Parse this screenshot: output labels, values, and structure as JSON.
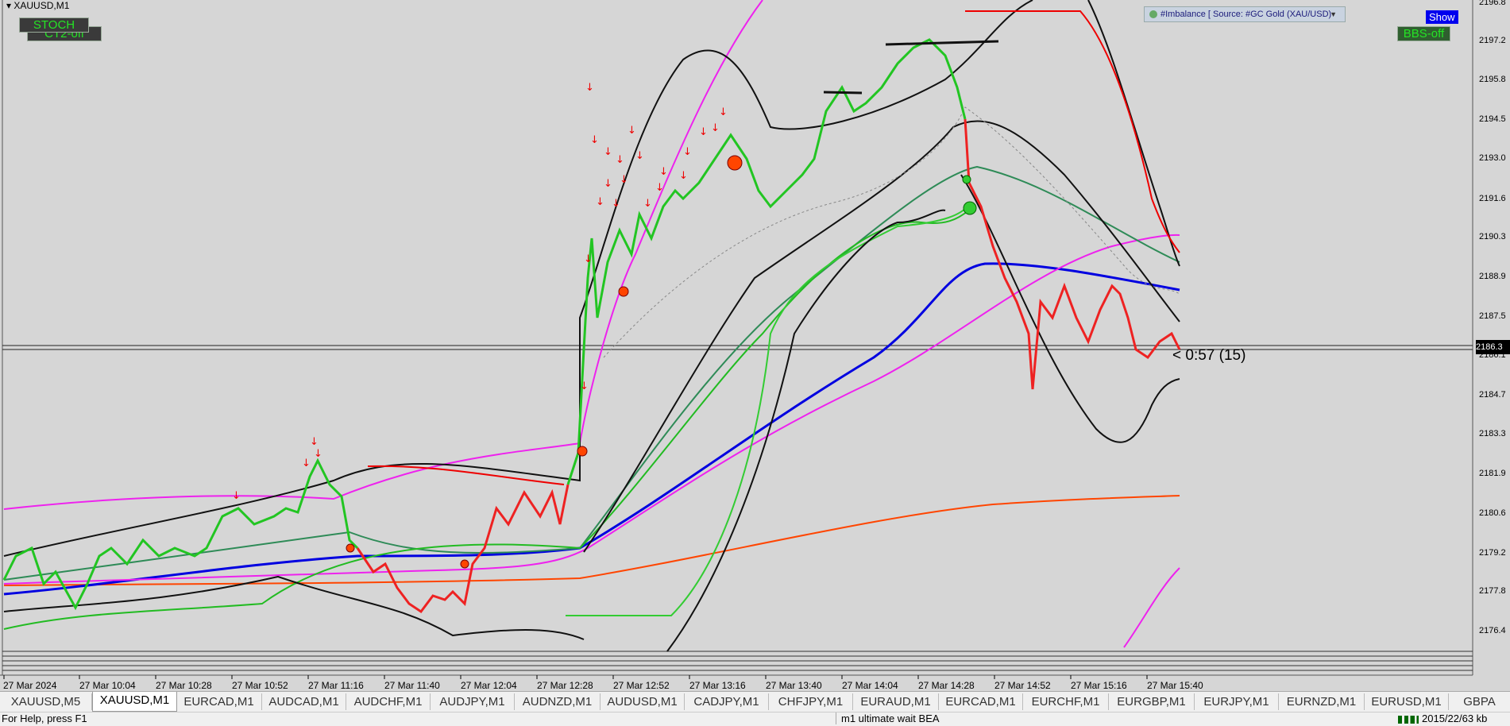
{
  "header": {
    "symbol": "XAUUSD,M1"
  },
  "indicators": {
    "stoch": "STOCH",
    "ct2": "CT2-off",
    "bbs": "BBS-off",
    "show": "Show",
    "imbalance": "#Imbalance [ Source: #GC Gold (XAU/USD)"
  },
  "timer": "< 0:57 (15)",
  "price_axis": [
    "2196.8",
    "2197.2",
    "2195.8",
    "2194.5",
    "2193.0",
    "2191.6",
    "2190.3",
    "2188.9",
    "2187.5",
    "2186.1",
    "2184.7",
    "2183.3",
    "2181.9",
    "2180.6",
    "2179.2",
    "2177.8",
    "2176.4"
  ],
  "current_price": "2186.3",
  "time_axis": [
    "27 Mar 2024",
    "27 Mar 10:04",
    "27 Mar 10:28",
    "27 Mar 10:52",
    "27 Mar 11:16",
    "27 Mar 11:40",
    "27 Mar 12:04",
    "27 Mar 12:28",
    "27 Mar 12:52",
    "27 Mar 13:16",
    "27 Mar 13:40",
    "27 Mar 14:04",
    "27 Mar 14:28",
    "27 Mar 14:52",
    "27 Mar 15:16",
    "27 Mar 15:40"
  ],
  "tabs": [
    "XAUUSD,M5",
    "XAUUSD,M1",
    "EURCAD,M1",
    "AUDCAD,M1",
    "AUDCHF,M1",
    "AUDJPY,M1",
    "AUDNZD,M1",
    "AUDUSD,M1",
    "CADJPY,M1",
    "CHFJPY,M1",
    "EURAUD,M1",
    "EURCAD,M1",
    "EURCHF,M1",
    "EURGBP,M1",
    "EURJPY,M1",
    "EURNZD,M1",
    "EURUSD,M1",
    "GBPA"
  ],
  "active_tab": "XAUUSD,M1",
  "status": {
    "help": "For Help, press F1",
    "profile": "m1 ultimate wait BEA",
    "traffic": "2015/22/63 kb"
  }
}
